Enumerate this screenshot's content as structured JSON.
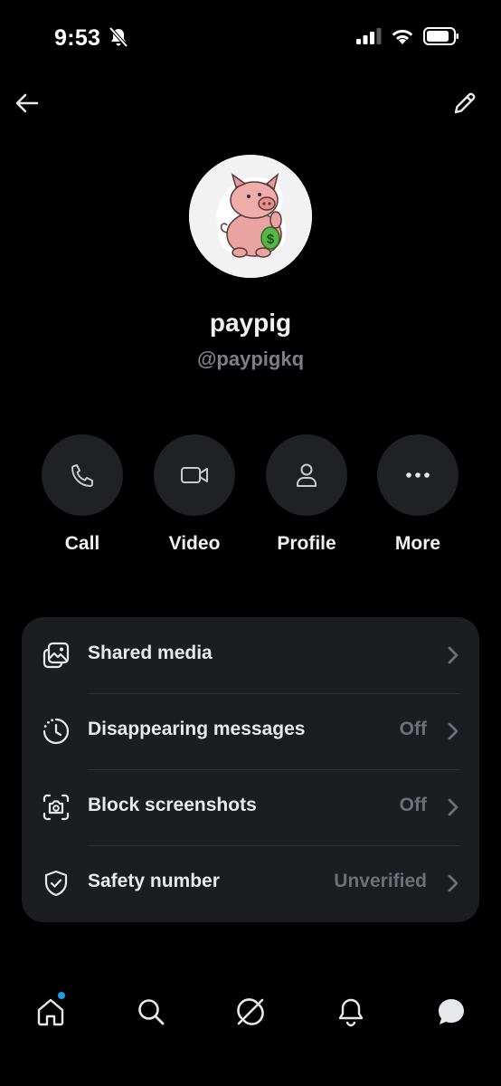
{
  "status_bar": {
    "time": "9:53",
    "icons": [
      "bell-slash-icon",
      "cellular-signal-icon",
      "wifi-icon",
      "battery-icon"
    ]
  },
  "header": {
    "back_icon": "arrow-left-icon",
    "edit_icon": "pencil-icon"
  },
  "profile": {
    "display_name": "paypig",
    "handle": "@paypigkq",
    "avatar": "cartoon pig sticker holding dollar money bag"
  },
  "actions": [
    {
      "label": "Call",
      "icon": "phone-icon"
    },
    {
      "label": "Video",
      "icon": "video-camera-icon"
    },
    {
      "label": "Profile",
      "icon": "person-icon"
    },
    {
      "label": "More",
      "icon": "ellipsis-icon"
    }
  ],
  "settings": [
    {
      "label": "Shared media",
      "value": "",
      "icon": "media-gallery-icon"
    },
    {
      "label": "Disappearing messages",
      "value": "Off",
      "icon": "timer-icon"
    },
    {
      "label": "Block screenshots",
      "value": "Off",
      "icon": "screenshot-camera-icon"
    },
    {
      "label": "Safety number",
      "value": "Unverified",
      "icon": "shield-check-icon"
    }
  ],
  "bottom_nav": [
    {
      "icon": "home-icon",
      "has_notification": true
    },
    {
      "icon": "search-icon"
    },
    {
      "icon": "grok-icon"
    },
    {
      "icon": "bell-icon"
    },
    {
      "icon": "messages-icon",
      "active": true
    }
  ],
  "colors": {
    "background": "#000000",
    "card": "#1c1d20",
    "button_circle": "#202124",
    "muted_text": "#6d7077",
    "notification_dot": "#1d9bf0"
  }
}
